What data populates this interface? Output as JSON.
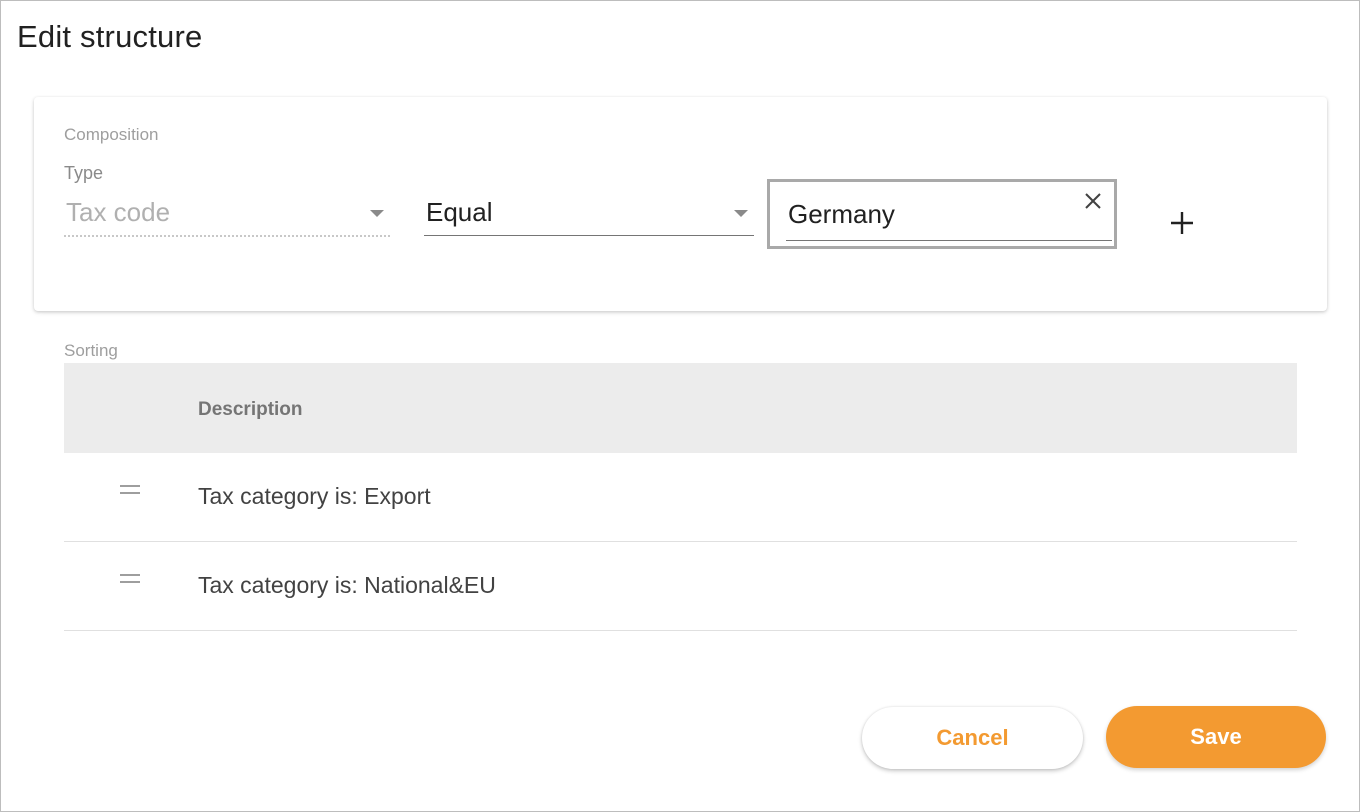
{
  "dialog": {
    "title": "Edit structure"
  },
  "composition": {
    "label": "Composition",
    "type_caption": "Type",
    "type_placeholder": "Tax code",
    "operator_value": "Equal",
    "value_input": "Germany",
    "icons": {
      "clear": "close-icon",
      "add": "plus-icon",
      "dropdown": "caret-down-icon"
    }
  },
  "sorting": {
    "label": "Sorting",
    "header": {
      "description": "Description"
    },
    "rows": [
      {
        "description": "Tax category is: Export",
        "handle_icon": "drag-handle-icon"
      },
      {
        "description": "Tax category is: National&EU",
        "handle_icon": "drag-handle-icon"
      }
    ]
  },
  "actions": {
    "cancel_label": "Cancel",
    "save_label": "Save"
  },
  "colors": {
    "accent": "#f39a31",
    "header_bg": "#ececec",
    "muted_text": "#9e9e9e"
  }
}
